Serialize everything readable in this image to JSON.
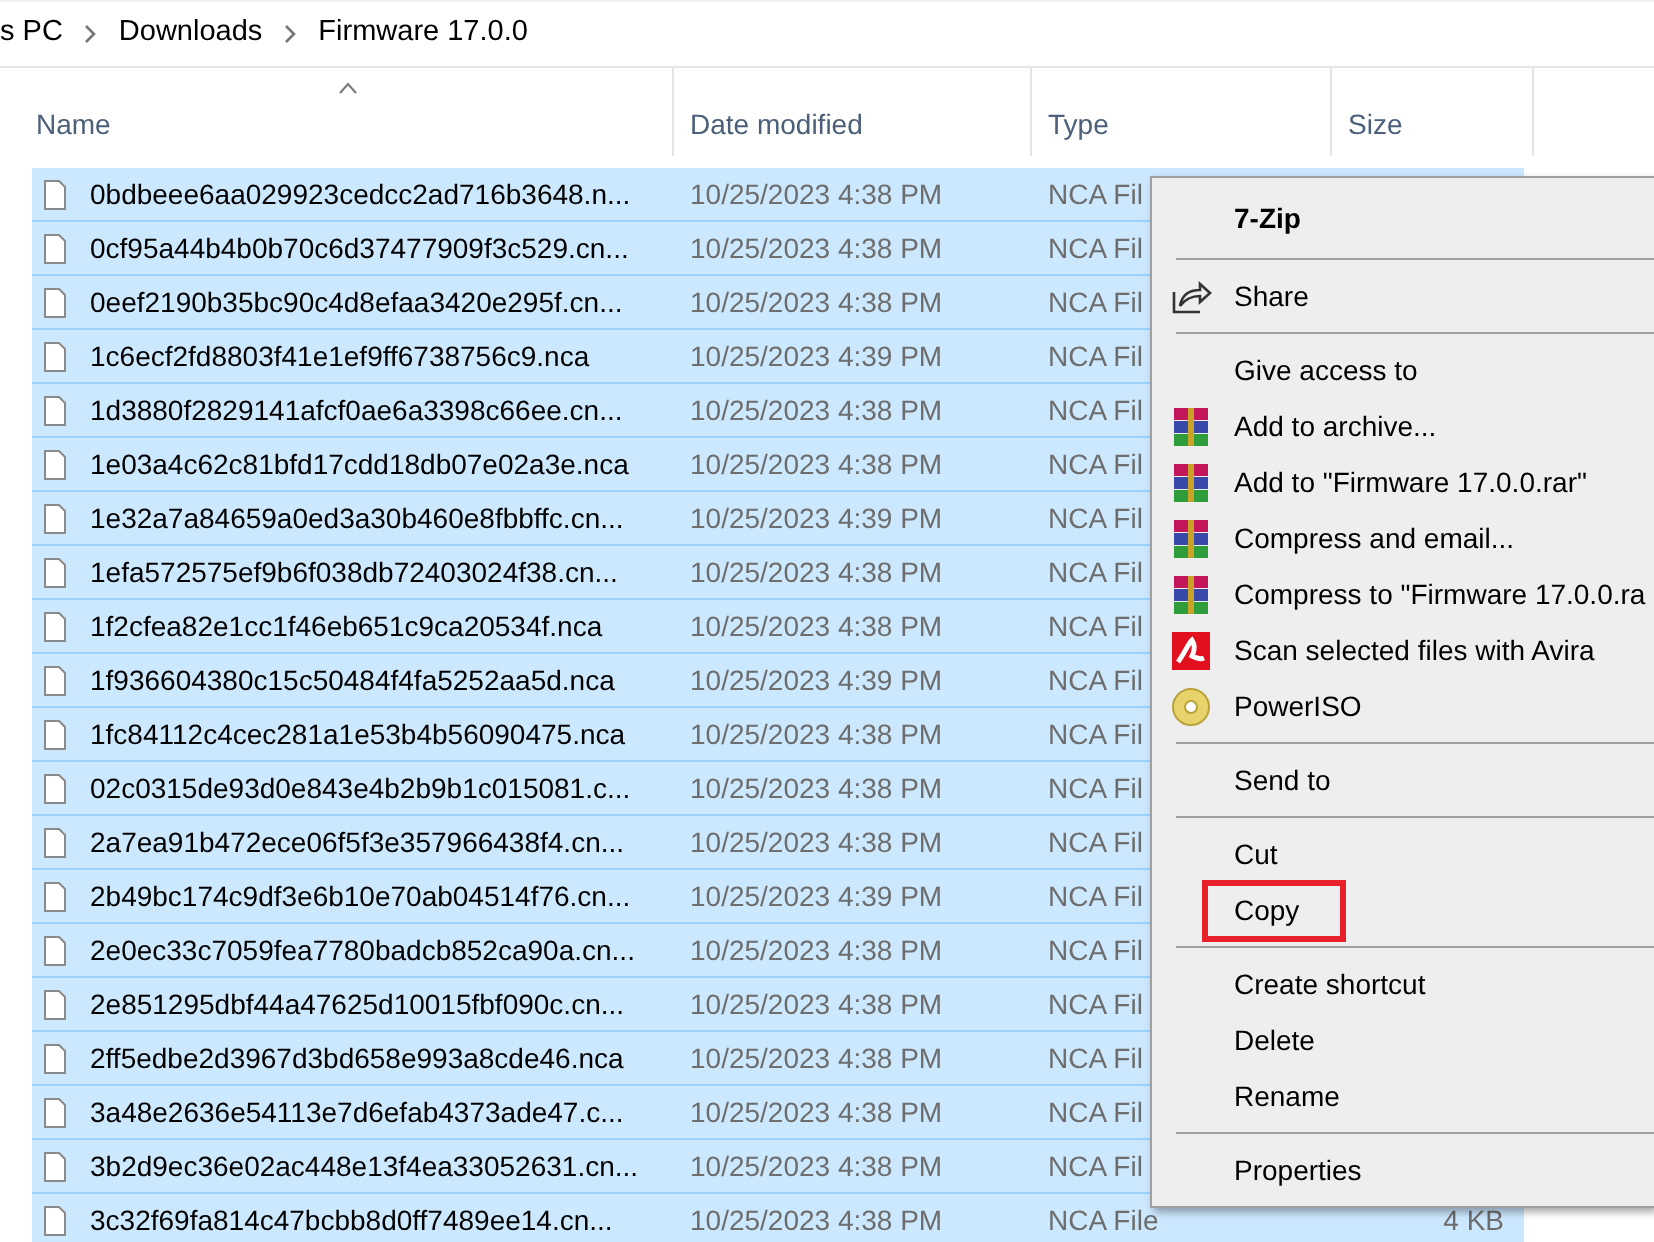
{
  "breadcrumb": [
    "s PC",
    "Downloads",
    "Firmware 17.0.0"
  ],
  "columns": [
    {
      "label": "Name",
      "sorted": true
    },
    {
      "label": "Date modified",
      "sorted": false
    },
    {
      "label": "Type",
      "sorted": false
    },
    {
      "label": "Size",
      "sorted": false
    }
  ],
  "files": [
    {
      "name": "0bdbeee6aa029923cedcc2ad716b3648.n...",
      "date": "10/25/2023 4:38 PM",
      "type": "NCA Fil",
      "selected": true
    },
    {
      "name": "0cf95a44b4b0b70c6d37477909f3c529.cn...",
      "date": "10/25/2023 4:38 PM",
      "type": "NCA Fil",
      "selected": true
    },
    {
      "name": "0eef2190b35bc90c4d8efaa3420e295f.cn...",
      "date": "10/25/2023 4:38 PM",
      "type": "NCA Fil",
      "selected": true
    },
    {
      "name": "1c6ecf2fd8803f41e1ef9ff6738756c9.nca",
      "date": "10/25/2023 4:39 PM",
      "type": "NCA Fil",
      "selected": true
    },
    {
      "name": "1d3880f2829141afcf0ae6a3398c66ee.cn...",
      "date": "10/25/2023 4:38 PM",
      "type": "NCA Fil",
      "selected": true
    },
    {
      "name": "1e03a4c62c81bfd17cdd18db07e02a3e.nca",
      "date": "10/25/2023 4:38 PM",
      "type": "NCA Fil",
      "selected": true
    },
    {
      "name": "1e32a7a84659a0ed3a30b460e8fbbffc.cn...",
      "date": "10/25/2023 4:39 PM",
      "type": "NCA Fil",
      "selected": true
    },
    {
      "name": "1efa572575ef9b6f038db72403024f38.cn...",
      "date": "10/25/2023 4:38 PM",
      "type": "NCA Fil",
      "selected": true
    },
    {
      "name": "1f2cfea82e1cc1f46eb651c9ca20534f.nca",
      "date": "10/25/2023 4:38 PM",
      "type": "NCA Fil",
      "selected": true
    },
    {
      "name": "1f936604380c15c50484f4fa5252aa5d.nca",
      "date": "10/25/2023 4:39 PM",
      "type": "NCA Fil",
      "selected": true
    },
    {
      "name": "1fc84112c4cec281a1e53b4b56090475.nca",
      "date": "10/25/2023 4:38 PM",
      "type": "NCA Fil",
      "selected": true
    },
    {
      "name": "02c0315de93d0e843e4b2b9b1c015081.c...",
      "date": "10/25/2023 4:38 PM",
      "type": "NCA Fil",
      "selected": true
    },
    {
      "name": "2a7ea91b472ece06f5f3e357966438f4.cn...",
      "date": "10/25/2023 4:38 PM",
      "type": "NCA Fil",
      "selected": true
    },
    {
      "name": "2b49bc174c9df3e6b10e70ab04514f76.cn...",
      "date": "10/25/2023 4:39 PM",
      "type": "NCA Fil",
      "selected": true
    },
    {
      "name": "2e0ec33c7059fea7780badcb852ca90a.cn...",
      "date": "10/25/2023 4:38 PM",
      "type": "NCA Fil",
      "selected": true
    },
    {
      "name": "2e851295dbf44a47625d10015fbf090c.cn...",
      "date": "10/25/2023 4:38 PM",
      "type": "NCA Fil",
      "selected": true
    },
    {
      "name": "2ff5edbe2d3967d3bd658e993a8cde46.nca",
      "date": "10/25/2023 4:38 PM",
      "type": "NCA Fil",
      "selected": true
    },
    {
      "name": "3a48e2636e54113e7d6efab4373ade47.c...",
      "date": "10/25/2023 4:38 PM",
      "type": "NCA Fil",
      "selected": true
    },
    {
      "name": "3b2d9ec36e02ac448e13f4ea33052631.cn...",
      "date": "10/25/2023 4:38 PM",
      "type": "NCA Fil",
      "selected": true
    },
    {
      "name": "3c32f69fa814c47bcbb8d0ff7489ee14.cn...",
      "date": "10/25/2023 4:38 PM",
      "type": "NCA File",
      "size": "4 KB",
      "selected": true
    }
  ],
  "context_menu": [
    {
      "kind": "title",
      "label": "7-Zip",
      "highlighted": false
    },
    {
      "kind": "separator"
    },
    {
      "kind": "command",
      "label": "Share",
      "highlighted": false
    },
    {
      "kind": "separator"
    },
    {
      "kind": "command",
      "label": "Give access to",
      "highlighted": false
    },
    {
      "kind": "command",
      "label": "Add to archive...",
      "highlighted": false
    },
    {
      "kind": "command",
      "label": "Add to \"Firmware 17.0.0.rar\"",
      "highlighted": false
    },
    {
      "kind": "command",
      "label": "Compress and email...",
      "highlighted": false
    },
    {
      "kind": "command",
      "label": "Compress to \"Firmware 17.0.0.ra",
      "highlighted": false
    },
    {
      "kind": "command",
      "label": "Scan selected files with Avira",
      "highlighted": false
    },
    {
      "kind": "command",
      "label": "PowerISO",
      "highlighted": false
    },
    {
      "kind": "separator"
    },
    {
      "kind": "command",
      "label": "Send to",
      "highlighted": false
    },
    {
      "kind": "separator"
    },
    {
      "kind": "command",
      "label": "Cut",
      "highlighted": false
    },
    {
      "kind": "command",
      "label": "Copy",
      "highlighted": true
    },
    {
      "kind": "separator"
    },
    {
      "kind": "command",
      "label": "Create shortcut",
      "highlighted": false
    },
    {
      "kind": "command",
      "label": "Delete",
      "highlighted": false
    },
    {
      "kind": "command",
      "label": "Rename",
      "highlighted": false
    },
    {
      "kind": "separator"
    },
    {
      "kind": "command",
      "label": "Properties",
      "highlighted": false
    }
  ]
}
